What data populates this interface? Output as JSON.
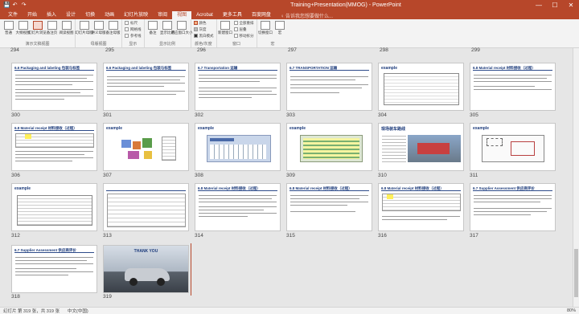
{
  "window": {
    "title": "Training+Presentation(MMOG) - PowerPoint",
    "minimize": "—",
    "maximize": "☐",
    "close": "✕"
  },
  "qat": {
    "save": "💾",
    "undo": "↶",
    "redo": "↷"
  },
  "tabs": [
    {
      "label": "文件",
      "active": false
    },
    {
      "label": "开始",
      "active": false
    },
    {
      "label": "插入",
      "active": false
    },
    {
      "label": "设计",
      "active": false
    },
    {
      "label": "切换",
      "active": false
    },
    {
      "label": "动画",
      "active": false
    },
    {
      "label": "幻灯片放映",
      "active": false
    },
    {
      "label": "审阅",
      "active": false
    },
    {
      "label": "视图",
      "active": true
    },
    {
      "label": "Acrobat",
      "active": false
    },
    {
      "label": "更多工具",
      "active": false
    },
    {
      "label": "百度网盘",
      "active": false
    }
  ],
  "tell_me": "♀ 告诉我您想要做什么...",
  "ribbon": {
    "groups": [
      {
        "label": "演示文稿视图",
        "buttons": [
          "普通",
          "大纲视图",
          "幻灯片浏览",
          "备注页",
          "阅读视图"
        ]
      },
      {
        "label": "母版视图",
        "buttons": [
          "幻灯片母版",
          "讲义母版",
          "备注母版"
        ]
      },
      {
        "label": "显示",
        "checks": [
          "标尺",
          "网格线",
          "参考线"
        ]
      },
      {
        "label": "显示比例",
        "buttons": [
          "备注",
          "显示比例",
          "适应窗口大小"
        ]
      },
      {
        "label": "颜色/灰度",
        "checks": [
          "颜色",
          "灰度",
          "黑白模式"
        ]
      },
      {
        "label": "窗口",
        "buttons": [
          "新建窗口"
        ],
        "checks": [
          "全部重排",
          "层叠",
          "移动拆分"
        ]
      },
      {
        "label": "宏",
        "buttons": [
          "切换窗口",
          "宏"
        ]
      }
    ]
  },
  "slides": [
    {
      "num": "294"
    },
    {
      "num": "295"
    },
    {
      "num": "296"
    },
    {
      "num": "297"
    },
    {
      "num": "298"
    },
    {
      "num": "299"
    },
    {
      "num": "300",
      "title": "6.6 Packaging and labeling 包装与标签"
    },
    {
      "num": "301",
      "title": "6.6 Packaging and labeling 包装与标签"
    },
    {
      "num": "302",
      "title": "6.7 Transportation 运输"
    },
    {
      "num": "303",
      "title": "6.7 TRANSPORTATION 运输"
    },
    {
      "num": "304",
      "title": "example"
    },
    {
      "num": "305",
      "title": "6.8 Material receipt 材料接收（过程）"
    },
    {
      "num": "306",
      "title": "6.8 Material receipt 材料接收（过程）"
    },
    {
      "num": "307",
      "title": "example"
    },
    {
      "num": "308",
      "title": "example"
    },
    {
      "num": "309",
      "title": "example"
    },
    {
      "num": "310",
      "title": "现场装车路线"
    },
    {
      "num": "311",
      "title": "example"
    },
    {
      "num": "312",
      "title": "example"
    },
    {
      "num": "313",
      "title": ""
    },
    {
      "num": "314",
      "title": "6.8 Material receipt 材料接收（过程）"
    },
    {
      "num": "315",
      "title": "6.8 Material receipt 材料接收（过程）"
    },
    {
      "num": "316",
      "title": "6.8 Material receipt 材料接收（过程）"
    },
    {
      "num": "317",
      "title": "6.7 Supplier Assessment 供应商评价"
    },
    {
      "num": "318",
      "title": "6.7 Supplier Assessment 供应商评价"
    },
    {
      "num": "319",
      "title": "THANK YOU"
    }
  ],
  "status": {
    "slide_info": "幻灯片 第 319 张，共 319 张",
    "language": "中文(中国)",
    "zoom": "80%"
  }
}
